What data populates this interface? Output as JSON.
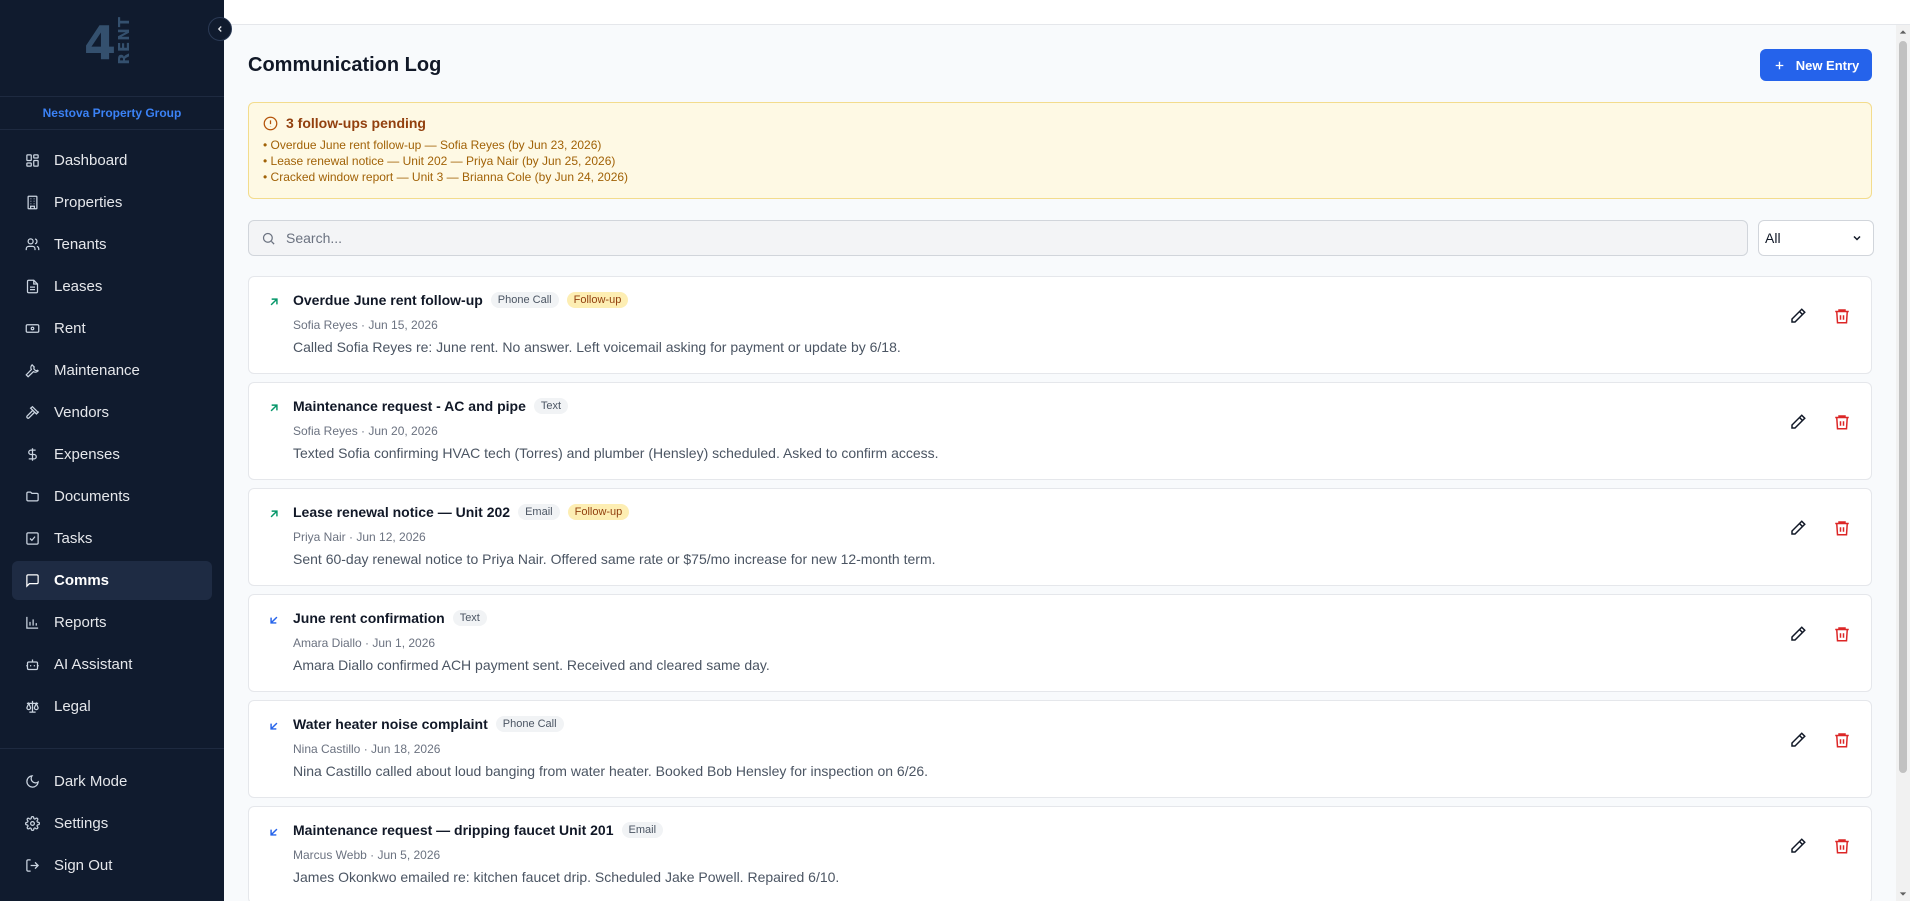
{
  "brand": {
    "logo_number": "4",
    "logo_word": "RENT",
    "org_name": "Nestova Property Group"
  },
  "sidebar": {
    "items": [
      {
        "label": "Dashboard",
        "icon": "dashboard-icon"
      },
      {
        "label": "Properties",
        "icon": "building-icon"
      },
      {
        "label": "Tenants",
        "icon": "users-icon"
      },
      {
        "label": "Leases",
        "icon": "file-text-icon"
      },
      {
        "label": "Rent",
        "icon": "banknote-icon"
      },
      {
        "label": "Maintenance",
        "icon": "wrench-icon"
      },
      {
        "label": "Vendors",
        "icon": "hammer-icon"
      },
      {
        "label": "Expenses",
        "icon": "dollar-icon"
      },
      {
        "label": "Documents",
        "icon": "folder-icon"
      },
      {
        "label": "Tasks",
        "icon": "checkbox-icon"
      },
      {
        "label": "Comms",
        "icon": "message-icon",
        "active": true
      },
      {
        "label": "Reports",
        "icon": "bar-chart-icon"
      },
      {
        "label": "AI Assistant",
        "icon": "bot-icon"
      },
      {
        "label": "Legal",
        "icon": "scale-icon"
      }
    ],
    "bottom": [
      {
        "label": "Dark Mode",
        "icon": "moon-icon"
      },
      {
        "label": "Settings",
        "icon": "gear-icon"
      },
      {
        "label": "Sign Out",
        "icon": "logout-icon"
      }
    ]
  },
  "main": {
    "title": "Communication Log",
    "new_entry_label": "New Entry",
    "alert": {
      "title": "3 follow-ups pending",
      "items": [
        "• Overdue June rent follow-up — Sofia Reyes (by Jun 23, 2026)",
        "• Lease renewal notice — Unit 202 — Priya Nair (by Jun 25, 2026)",
        "• Cracked window report — Unit 3 — Brianna Cole (by Jun 24, 2026)"
      ]
    },
    "search_placeholder": "Search...",
    "filter_value": "All",
    "entries": [
      {
        "direction": "outgoing",
        "title": "Overdue June rent follow-up",
        "type": "Phone Call",
        "followup": "Follow-up",
        "meta": "Sofia Reyes · Jun 15, 2026",
        "body": "Called Sofia Reyes re: June rent. No answer. Left voicemail asking for payment or update by 6/18."
      },
      {
        "direction": "outgoing",
        "title": "Maintenance request - AC and pipe",
        "type": "Text",
        "followup": "",
        "meta": "Sofia Reyes · Jun 20, 2026",
        "body": "Texted Sofia confirming HVAC tech (Torres) and plumber (Hensley) scheduled. Asked to confirm access."
      },
      {
        "direction": "outgoing",
        "title": "Lease renewal notice — Unit 202",
        "type": "Email",
        "followup": "Follow-up",
        "meta": "Priya Nair · Jun 12, 2026",
        "body": "Sent 60-day renewal notice to Priya Nair. Offered same rate or $75/mo increase for new 12-month term."
      },
      {
        "direction": "incoming",
        "title": "June rent confirmation",
        "type": "Text",
        "followup": "",
        "meta": "Amara Diallo · Jun 1, 2026",
        "body": "Amara Diallo confirmed ACH payment sent. Received and cleared same day."
      },
      {
        "direction": "incoming",
        "title": "Water heater noise complaint",
        "type": "Phone Call",
        "followup": "",
        "meta": "Nina Castillo · Jun 18, 2026",
        "body": "Nina Castillo called about loud banging from water heater. Booked Bob Hensley for inspection on 6/26."
      },
      {
        "direction": "incoming",
        "title": "Maintenance request — dripping faucet Unit 201",
        "type": "Email",
        "followup": "",
        "meta": "Marcus Webb · Jun 5, 2026",
        "body": "James Okonkwo emailed re: kitchen faucet drip. Scheduled Jake Powell. Repaired 6/10."
      }
    ]
  },
  "colors": {
    "sidebar_bg": "#101b2e",
    "accent": "#2563eb",
    "outgoing": "#059669",
    "incoming": "#2563eb",
    "delete": "#dc2626",
    "alert_bg": "#fef9e4"
  }
}
